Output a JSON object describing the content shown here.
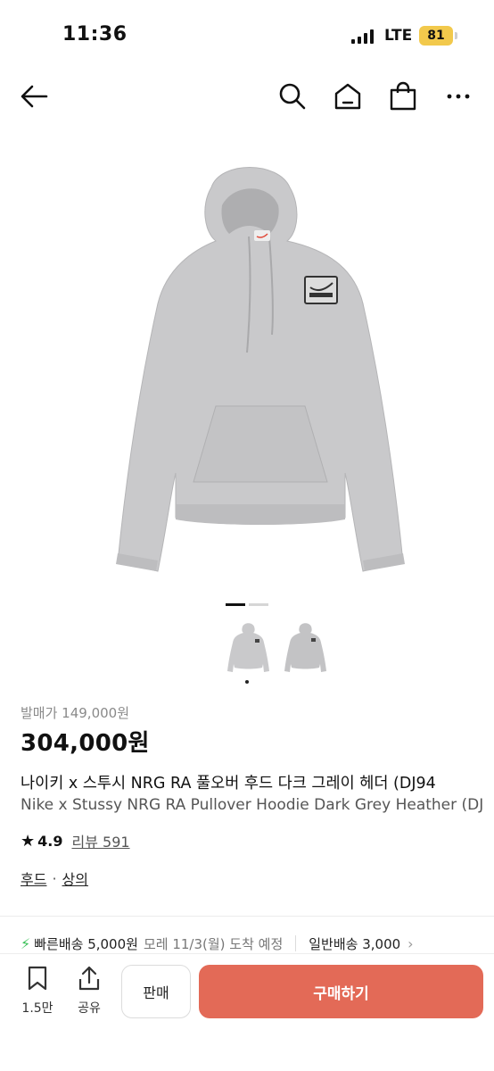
{
  "status_bar": {
    "time": "11:36",
    "network": "LTE",
    "battery": "81"
  },
  "product": {
    "release_price": "발매가 149,000원",
    "price": "304,000원",
    "title_ko": "나이키 x 스투시 NRG RA 풀오버 후드 다크 그레이 헤더 (DJ94",
    "title_en": "Nike x Stussy NRG RA Pullover Hoodie Dark Grey Heather (DJ",
    "rating": "4.9",
    "reviews": "리뷰 591",
    "categories": [
      "후드",
      "상의"
    ],
    "category_separator": "·",
    "image_index": 1,
    "image_count": 2
  },
  "shipping": {
    "fast_label": "빠른배송 5,000원",
    "fast_eta": "모레 11/3(월) 도착 예정",
    "normal_label": "일반배송 3,000"
  },
  "bottom_bar": {
    "wish_count": "1.5만",
    "share_label": "공유",
    "sell_label": "판매",
    "buy_label": "구매하기"
  },
  "colors": {
    "buy_button": "#e36a57",
    "fast_bolt": "#3cc15a",
    "battery": "#f2c94c"
  },
  "icons": [
    "back-arrow-icon",
    "search-icon",
    "home-icon",
    "shopping-bag-icon",
    "more-icon",
    "bookmark-icon",
    "share-icon",
    "bolt-icon",
    "chevron-right-icon"
  ]
}
